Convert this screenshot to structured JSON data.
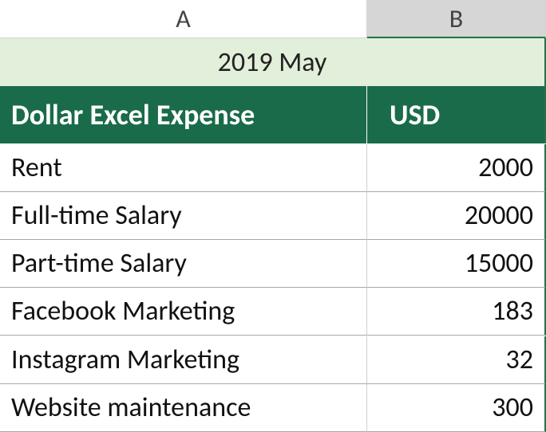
{
  "columns": {
    "a": "A",
    "b": "B"
  },
  "title": "2019 May",
  "header": {
    "label": "Dollar Excel Expense",
    "value": "USD"
  },
  "rows": [
    {
      "label": "Rent",
      "value": "2000"
    },
    {
      "label": "Full-time Salary",
      "value": "20000"
    },
    {
      "label": "Part-time Salary",
      "value": "15000"
    },
    {
      "label": "Facebook Marketing",
      "value": "183"
    },
    {
      "label": "Instagram Marketing",
      "value": "32"
    },
    {
      "label": "Website maintenance",
      "value": "300"
    }
  ],
  "chart_data": {
    "type": "table",
    "title": "2019 May",
    "columns": [
      "Dollar Excel Expense",
      "USD"
    ],
    "rows": [
      [
        "Rent",
        2000
      ],
      [
        "Full-time Salary",
        20000
      ],
      [
        "Part-time Salary",
        15000
      ],
      [
        "Facebook Marketing",
        183
      ],
      [
        "Instagram Marketing",
        32
      ],
      [
        "Website maintenance",
        300
      ]
    ]
  }
}
